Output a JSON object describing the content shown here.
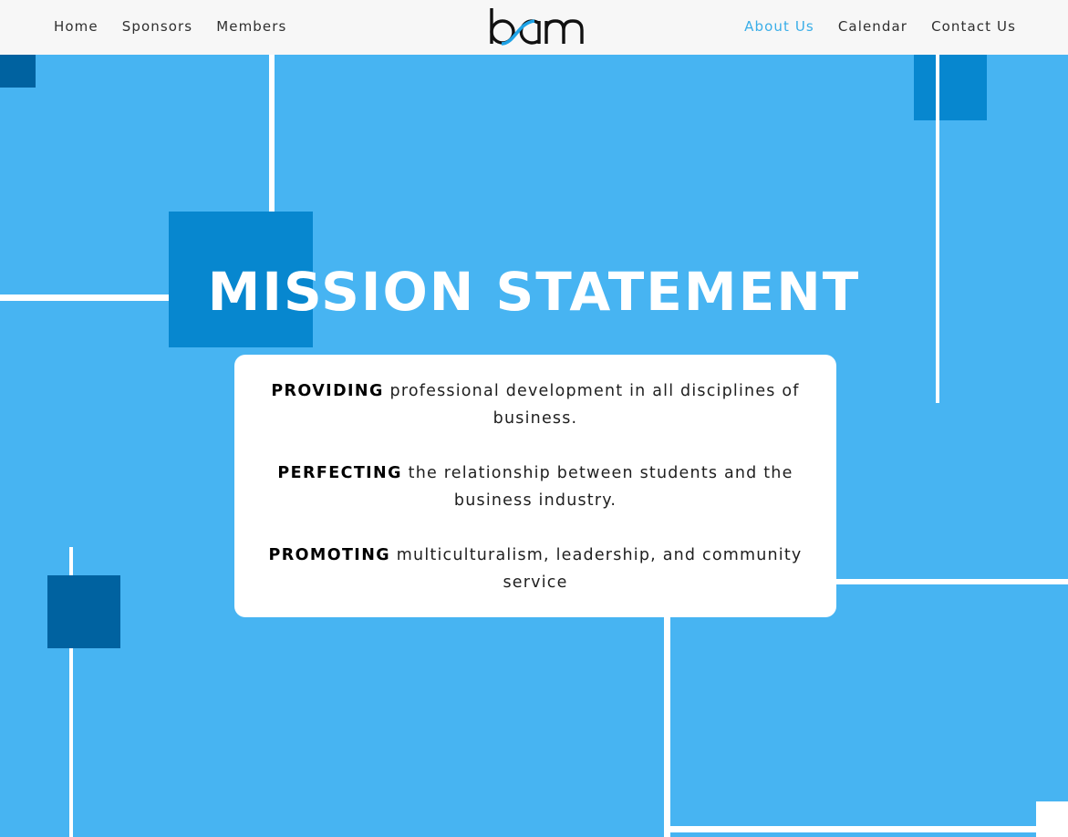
{
  "header": {
    "nav_left": [
      {
        "label": "Home",
        "active": false
      },
      {
        "label": "Sponsors",
        "active": false
      },
      {
        "label": "Members",
        "active": false
      }
    ],
    "logo_text": "bam",
    "nav_right": [
      {
        "label": "About Us",
        "active": true
      },
      {
        "label": "Calendar",
        "active": false
      },
      {
        "label": "Contact Us",
        "active": false
      }
    ]
  },
  "main": {
    "title": "MISSION STATEMENT",
    "statements": [
      {
        "keyword": "PROVIDING",
        "text": " professional development in all disciplines of business."
      },
      {
        "keyword": "PERFECTING",
        "text": " the relationship between students and the business industry."
      },
      {
        "keyword": "PROMOTING",
        "text": " multiculturalism, leadership, and community service"
      }
    ]
  },
  "colors": {
    "background": "#47b4f2",
    "accent": "#3aaee8",
    "square_dark": "#0062a0",
    "square_mid": "#0787cf",
    "header_bg": "#f7f7f7"
  }
}
